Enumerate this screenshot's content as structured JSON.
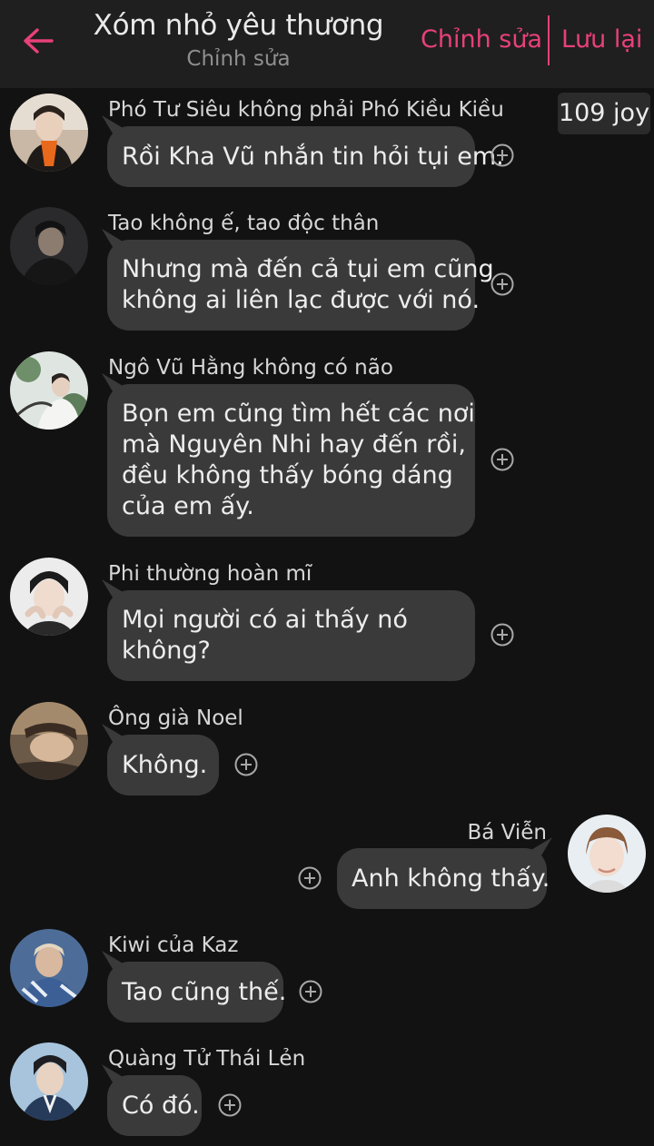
{
  "header": {
    "title": "Xóm nhỏ yêu thương",
    "subtitle": "Chỉnh sửa",
    "edit_label": "Chỉnh sửa",
    "save_label": "Lưu lại"
  },
  "joy_badge": "109 joy",
  "accent_color": "#e8407a",
  "messages": [
    {
      "sender": "Phó Tư Siêu không phải Phó Kiều Kiều",
      "lines": [
        "Rồi Kha Vũ nhắn tin hỏi tụi em."
      ]
    },
    {
      "sender": "Tao không ế, tao độc thân",
      "lines": [
        "Nhưng mà đến cả tụi em cũng",
        "không ai liên lạc được với nó."
      ]
    },
    {
      "sender": "Ngô Vũ Hằng không có não",
      "lines": [
        "Bọn em cũng tìm hết các nơi",
        "mà Nguyên Nhi hay đến rồi,",
        "đều không thấy bóng dáng",
        "của em ấy."
      ]
    },
    {
      "sender": "Phi thường hoàn mĩ",
      "lines": [
        "Mọi người có ai thấy nó",
        "không?"
      ]
    },
    {
      "sender": "Ông già Noel",
      "lines": [
        "Không."
      ]
    },
    {
      "sender": "Bá Viễn",
      "lines": [
        "Anh không thấy."
      ]
    },
    {
      "sender": "Kiwi của Kaz",
      "lines": [
        "Tao cũng thế."
      ]
    },
    {
      "sender": "Quàng Tử Thái Lẻn",
      "lines": [
        "Có đó."
      ]
    }
  ]
}
